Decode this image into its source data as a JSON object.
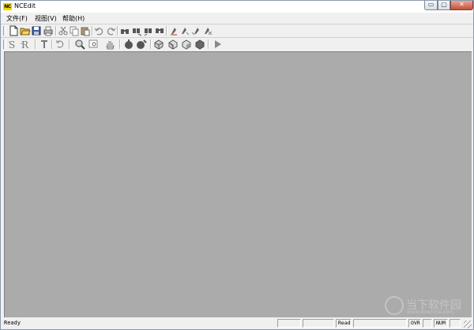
{
  "window": {
    "logo_text": "NC",
    "title": "NCEdit",
    "controls": {
      "minimize": "▭",
      "maximize": "▢",
      "close": "✕"
    }
  },
  "menu": {
    "items": [
      {
        "label": "文件(F)"
      },
      {
        "label": "视图(V)"
      },
      {
        "label": "帮助(H)"
      }
    ]
  },
  "toolbar1": {
    "buttons": [
      "new-file-icon",
      "open-folder-icon",
      "save-icon",
      "print-icon",
      "cut-icon",
      "copy-icon",
      "paste-icon",
      "undo-icon",
      "redo-icon",
      "find-icon",
      "find-next-icon",
      "find-prev-icon",
      "replace-icon",
      "bookmark-toggle-icon",
      "bookmark-next-icon",
      "bookmark-prev-icon",
      "bookmark-clear-icon"
    ]
  },
  "toolbar2": {
    "buttons": [
      "syntax-check-icon",
      "renumber-icon",
      "tool-icon",
      "rotate-icon",
      "zoom-in-icon",
      "zoom-window-icon",
      "pan-hand-icon",
      "simulate-icon",
      "simulate-step-icon",
      "view-iso-icon",
      "view-front-icon",
      "view-side-icon",
      "view-top-icon",
      "play-icon"
    ]
  },
  "statusbar": {
    "ready": "Ready",
    "mode": "Read",
    "ovr": "OVR",
    "num": "NUM"
  },
  "watermark": {
    "name": "当下软件园",
    "url": "www.downxia.com"
  },
  "colors": {
    "client_bg": "#ababab",
    "chrome_bg": "#f0f0f0",
    "logo_bg": "#f2d400"
  }
}
